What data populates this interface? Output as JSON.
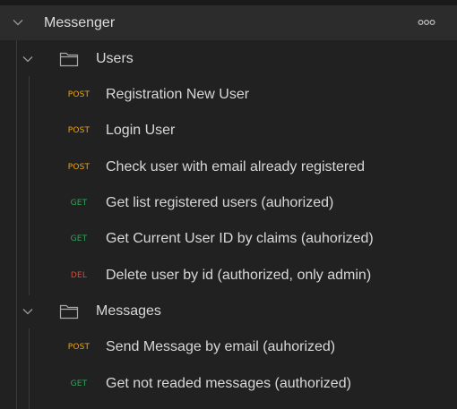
{
  "collection": {
    "name": "Messenger",
    "expanded": true,
    "more_icon": "more-horizontal-icon"
  },
  "folders": [
    {
      "name": "Users",
      "expanded": true,
      "requests": [
        {
          "method": "POST",
          "name": "Registration New User"
        },
        {
          "method": "POST",
          "name": "Login User"
        },
        {
          "method": "POST",
          "name": "Check user with email already registered"
        },
        {
          "method": "GET",
          "name": "Get list registered users (auhorized)"
        },
        {
          "method": "GET",
          "name": "Get Current User ID by claims (auhorized)"
        },
        {
          "method": "DEL",
          "name": "Delete user by id (authorized, only admin)"
        }
      ]
    },
    {
      "name": "Messages",
      "expanded": true,
      "requests": [
        {
          "method": "POST",
          "name": "Send Message by email (auhorized)"
        },
        {
          "method": "GET",
          "name": "Get not readed messages (authorized)"
        }
      ]
    }
  ],
  "colors": {
    "POST": "#f0a30a",
    "GET": "#2fa55b",
    "DEL": "#e0493f",
    "background": "#212121",
    "header_background": "#2c2c2c"
  }
}
